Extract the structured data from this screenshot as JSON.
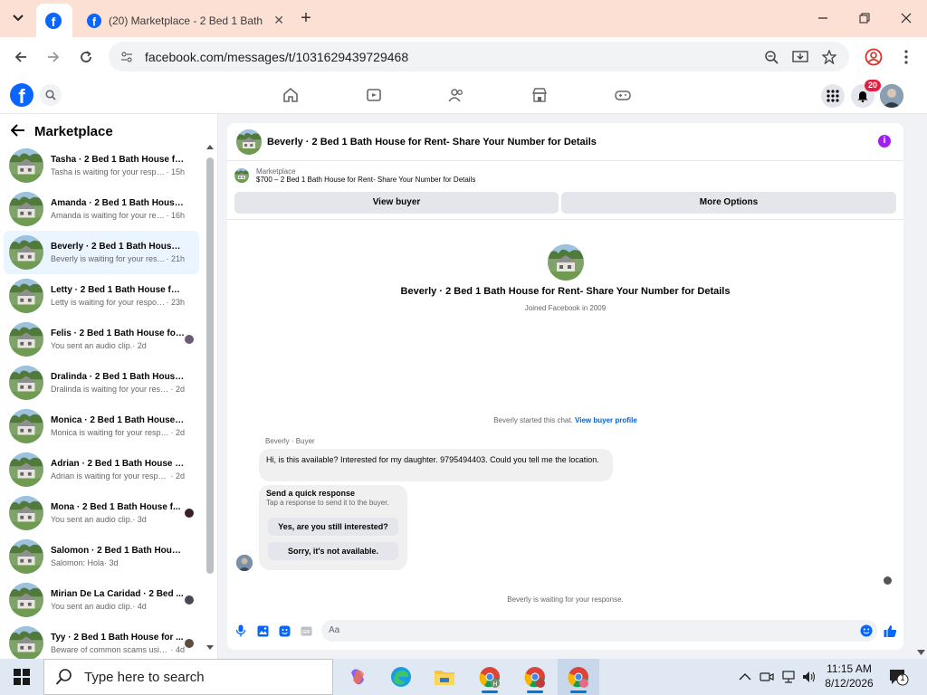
{
  "browser": {
    "tabs": [
      {
        "label": "",
        "icon": "facebook-icon",
        "active": true
      },
      {
        "label": "(20) Marketplace - 2 Bed 1 Bath",
        "icon": "facebook-icon",
        "active": false
      }
    ],
    "url": "facebook.com/messages/t/1031629439729468"
  },
  "fb": {
    "notification_count": "20"
  },
  "sidebar": {
    "title": "Marketplace",
    "conversations": [
      {
        "name": "Tasha · 2 Bed 1 Bath House for ...",
        "snippet": "Tasha is waiting for your response.",
        "time": " · 15h"
      },
      {
        "name": "Amanda · 2 Bed 1 Bath House f...",
        "snippet": "Amanda is waiting for your resp...",
        "time": " · 16h"
      },
      {
        "name": "Beverly · 2 Bed 1 Bath House fo...",
        "snippet": "Beverly is waiting for your respo...",
        "time": " · 21h",
        "active": true
      },
      {
        "name": "Letty · 2 Bed 1 Bath House for ...",
        "snippet": "Letty is waiting for your response.",
        "time": " · 23h"
      },
      {
        "name": "Felis · 2 Bed 1 Bath House for...",
        "snippet": "You sent an audio clip.",
        "time": " · 2d"
      },
      {
        "name": "Dralinda · 2 Bed 1 Bath House f...",
        "snippet": "Dralinda is waiting for your respo...",
        "time": " · 2d"
      },
      {
        "name": "Monica · 2 Bed 1 Bath House fo...",
        "snippet": "Monica is waiting for your respon...",
        "time": " · 2d"
      },
      {
        "name": "Adrian · 2 Bed 1 Bath House for...",
        "snippet": "Adrian is waiting for your response.",
        "time": " · 2d"
      },
      {
        "name": "Mona · 2 Bed 1 Bath House f...",
        "snippet": "You sent an audio clip.",
        "time": " · 3d"
      },
      {
        "name": "Salomon · 2 Bed 1 Bath House f...",
        "snippet": "Salomon: Hola",
        "time": " · 3d"
      },
      {
        "name": "Mirian De La Caridad · 2 Bed ...",
        "snippet": "You sent an audio clip.",
        "time": " · 4d"
      },
      {
        "name": "Tyy · 2 Bed 1 Bath House for ...",
        "snippet": "Beware of common scams usin...",
        "time": " · 4d"
      }
    ]
  },
  "chat": {
    "header_title": "Beverly · 2 Bed 1 Bath House for Rent- Share Your Number for Details",
    "marketplace_label": "Marketplace",
    "listing": "$700 – 2 Bed 1 Bath House for Rent- Share Your Number for Details",
    "view_buyer": "View buyer",
    "more_options": "More Options",
    "profile_name": "Beverly · 2 Bed 1 Bath House for Rent- Share Your Number for Details",
    "joined": "Joined Facebook in 2009",
    "started_text": "Beverly started this chat.",
    "view_buyer_profile": "View buyer profile",
    "sender_label": "Beverly · Buyer",
    "message": "Hi, is this available?  Interested for my daughter. 9795494403. Could you tell me the location.",
    "quick_title": "Send a quick response",
    "quick_sub": "Tap a response to send it to the buyer.",
    "quick_options": [
      "Yes, are you still interested?",
      "Sorry, it's not available."
    ],
    "waiting": "Beverly is waiting for your response.",
    "composer_placeholder": "Aa"
  },
  "taskbar": {
    "search_placeholder": "Type here to search",
    "time": "11:15 AM",
    "date": "8/12/2026",
    "notification_count": "1"
  }
}
